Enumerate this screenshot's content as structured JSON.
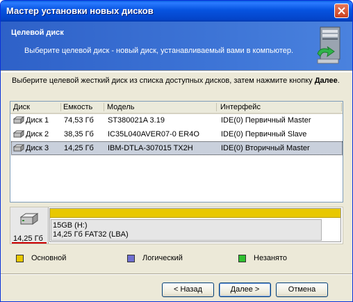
{
  "window": {
    "title": "Мастер установки новых дисков"
  },
  "header": {
    "title": "Целевой диск",
    "subtitle": "Выберите целевой диск - новый диск, устанавливаемый вами в компьютер."
  },
  "instruction": {
    "text": "Выберите целевой жесткий диск из списка доступных дисков, затем нажмите кнопку",
    "bold": "Далее",
    "end": "."
  },
  "disk_table": {
    "columns": [
      "Диск",
      "Емкость",
      "Модель",
      "Интерфейс"
    ],
    "rows": [
      {
        "disk": "Диск 1",
        "capacity": "74,53 Гб",
        "model": "ST380021A 3.19",
        "interface": "IDE(0) Первичный Master",
        "selected": false
      },
      {
        "disk": "Диск 2",
        "capacity": "38,35 Гб",
        "model": "IC35L040AVER07-0 ER4O",
        "interface": "IDE(0) Первичный Slave",
        "selected": false
      },
      {
        "disk": "Диск 3",
        "capacity": "14,25 Гб",
        "model": "IBM-DTLA-307015 TX2H",
        "interface": "IDE(0) Вторичный Master",
        "selected": true
      }
    ]
  },
  "disk_map": {
    "disk_size": "14,25 Гб",
    "partition_line1": "15GB (H:)",
    "partition_line2": "14,25 Гб  FAT32 (LBA)"
  },
  "legend": [
    {
      "label": "Основной",
      "color": "#e8c800"
    },
    {
      "label": "Логический",
      "color": "#6f6fd0"
    },
    {
      "label": "Незанято",
      "color": "#30c030"
    }
  ],
  "buttons": {
    "back": "< Назад",
    "next": "Далее >",
    "cancel": "Отмена"
  }
}
